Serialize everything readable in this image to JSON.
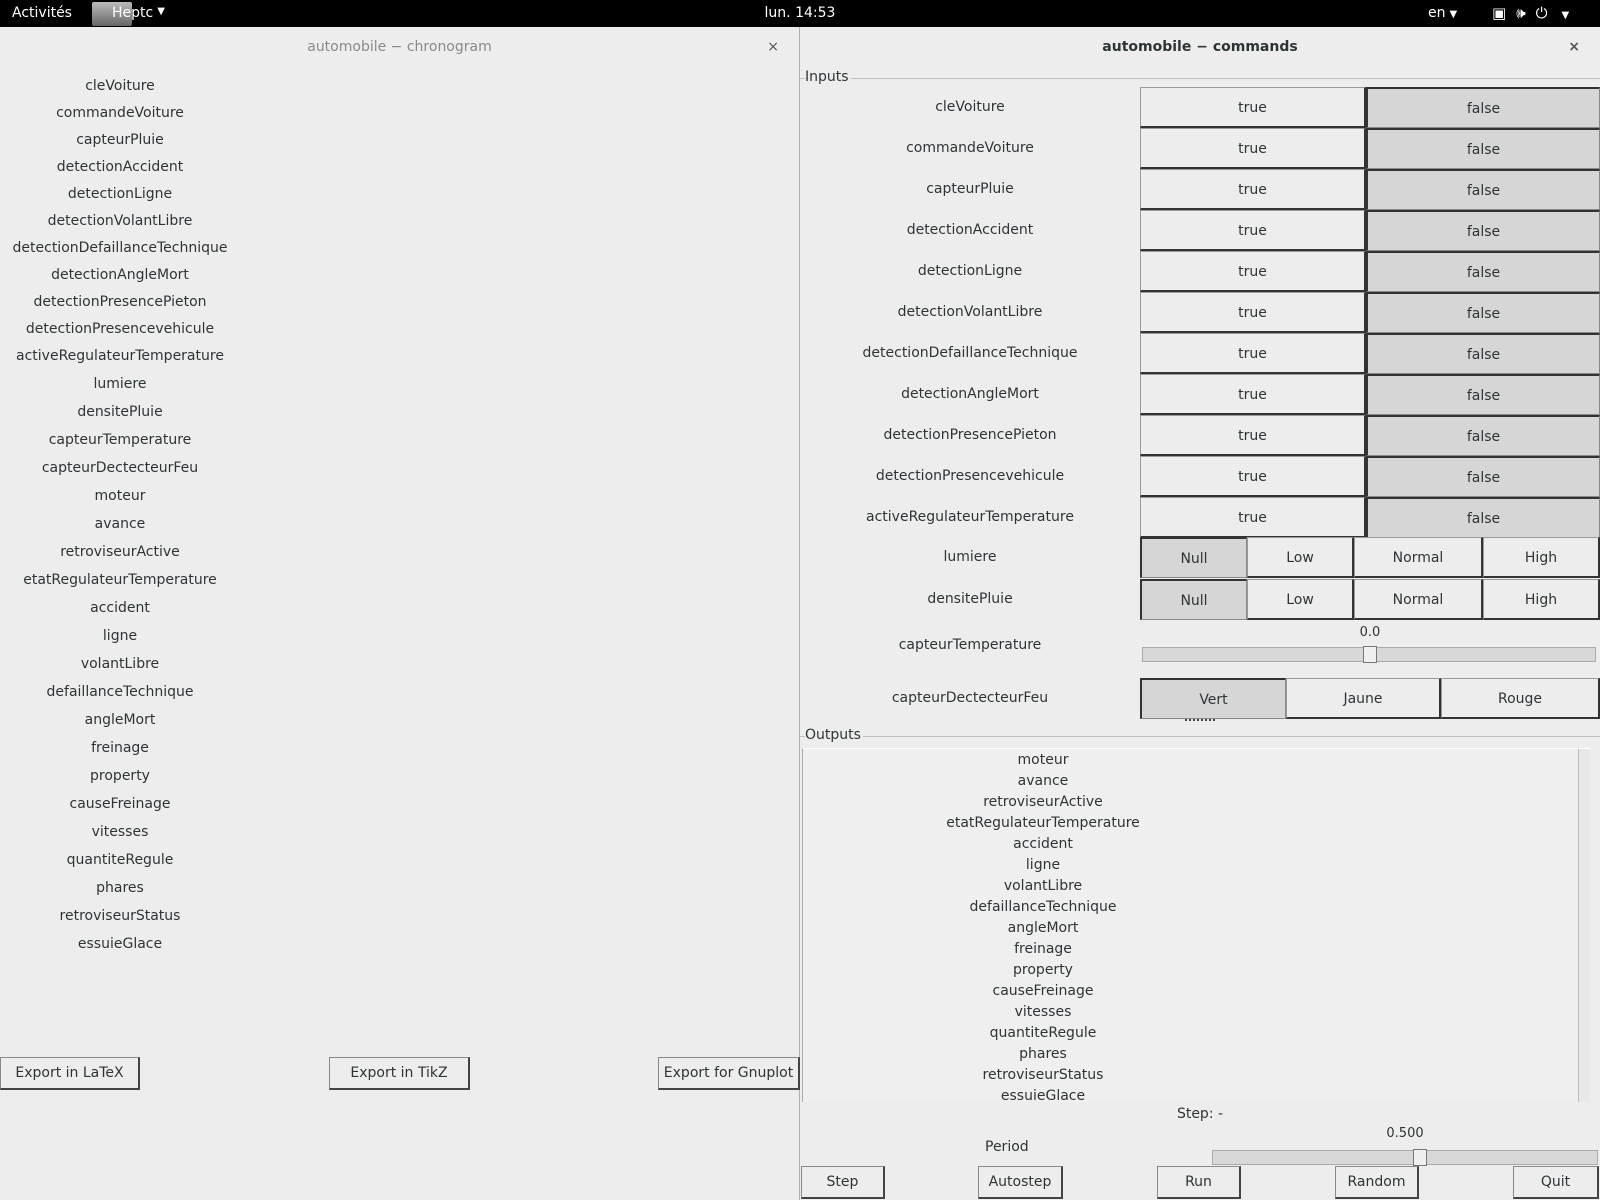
{
  "topbar": {
    "activities": "Activités",
    "app_name": "Heptc",
    "clock": "lun. 14:53",
    "lang": "en",
    "icons": [
      "window-icon",
      "volume-icon",
      "power-icon"
    ]
  },
  "chronogram": {
    "title": "automobile − chronogram",
    "close": "×",
    "signals": [
      "cleVoiture",
      "commandeVoiture",
      "capteurPluie",
      "detectionAccident",
      "detectionLigne",
      "detectionVolantLibre",
      "detectionDefaillanceTechnique",
      "detectionAngleMort",
      "detectionPresencePieton",
      "detectionPresencevehicule",
      "activeRegulateurTemperature",
      "lumiere",
      "densitePluie",
      "capteurTemperature",
      "capteurDectecteurFeu",
      "moteur",
      "avance",
      "retroviseurActive",
      "etatRegulateurTemperature",
      "accident",
      "ligne",
      "volantLibre",
      "defaillanceTechnique",
      "angleMort",
      "freinage",
      "property",
      "causeFreinage",
      "vitesses",
      "quantiteRegule",
      "phares",
      "retroviseurStatus",
      "essuieGlace"
    ],
    "export_latex": "Export in LaTeX",
    "export_tikz": "Export in TikZ",
    "export_gnuplot": "Export for Gnuplot"
  },
  "commands": {
    "title": "automobile − commands",
    "close": "×",
    "inputs_label": "Inputs",
    "bool_inputs": [
      "cleVoiture",
      "commandeVoiture",
      "capteurPluie",
      "detectionAccident",
      "detectionLigne",
      "detectionVolantLibre",
      "detectionDefaillanceTechnique",
      "detectionAngleMort",
      "detectionPresencePieton",
      "detectionPresencevehicule",
      "activeRegulateurTemperature"
    ],
    "true_label": "true",
    "false_label": "false",
    "selected_bool": "false",
    "lumiere": {
      "label": "lumiere",
      "options": [
        "Null",
        "Low",
        "Normal",
        "High"
      ],
      "selected": "Null"
    },
    "densitePluie": {
      "label": "densitePluie",
      "options": [
        "Null",
        "Low",
        "Normal",
        "High"
      ],
      "selected": "Null"
    },
    "capteurTemperature": {
      "label": "capteurTemperature",
      "value": "0.0",
      "fraction": 0.5
    },
    "capteurDectecteurFeu": {
      "label": "capteurDectecteurFeu",
      "options": [
        "Vert",
        "Jaune",
        "Rouge"
      ],
      "selected": "Vert"
    },
    "outputs_label": "Outputs",
    "outputs": [
      "moteur",
      "avance",
      "retroviseurActive",
      "etatRegulateurTemperature",
      "accident",
      "ligne",
      "volantLibre",
      "defaillanceTechnique",
      "angleMort",
      "freinage",
      "property",
      "causeFreinage",
      "vitesses",
      "quantiteRegule",
      "phares",
      "retroviseurStatus",
      "essuieGlace"
    ],
    "step_text": "Step: -",
    "period": {
      "label": "Period",
      "value": "0.500",
      "fraction": 0.5
    },
    "buttons": {
      "step": "Step",
      "autostep": "Autostep",
      "run": "Run",
      "random": "Random",
      "quit": "Quit"
    }
  }
}
